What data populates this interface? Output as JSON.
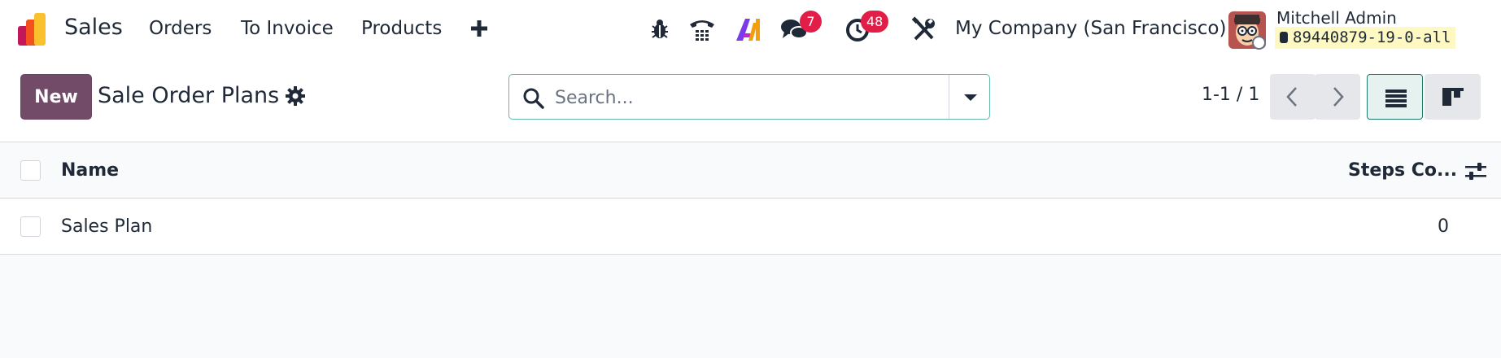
{
  "navbar": {
    "app_name": "Sales",
    "menu": [
      "Orders",
      "To Invoice",
      "Products"
    ],
    "plus_icon": "plus-icon",
    "systray": {
      "debug_icon": "bug-icon",
      "phone_icon": "phone-icon",
      "ai_icon": "ai-icon",
      "messages_icon": "chat-icon",
      "messages_count": "7",
      "activities_icon": "clock-icon",
      "activities_count": "48",
      "tools_icon": "wrench-screwdriver-icon"
    },
    "company": "My Company (San Francisco)",
    "user_name": "Mitchell Admin",
    "database": "89440879-19-0-all"
  },
  "control_panel": {
    "new_button": "New",
    "title": "Sale Order Plans",
    "settings_icon": "gear-icon",
    "search_placeholder": "Search...",
    "pager": "1-1 / 1"
  },
  "list": {
    "columns": [
      "Name",
      "Steps Co..."
    ],
    "rows": [
      {
        "name": "Sales Plan",
        "steps": "0"
      }
    ]
  },
  "colors": {
    "brand": "#714b67",
    "badge": "#e11d48",
    "accent": "#1f7a6a"
  }
}
